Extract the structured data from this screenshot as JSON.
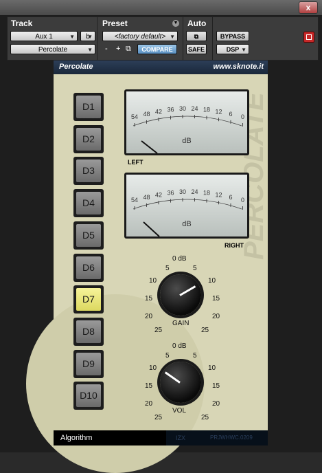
{
  "window": {
    "close_label": "x"
  },
  "header": {
    "track_label": "Track",
    "preset_label": "Preset",
    "auto_label": "Auto",
    "track_select": "Aux 1",
    "track_variant": "b",
    "plugin_select": "Percolate",
    "preset_select": "<factory default>",
    "minus": "-",
    "plus": "+",
    "compare": "COMPARE",
    "bypass": "BYPASS",
    "safe": "SAFE",
    "dsp": "DSP"
  },
  "plugin": {
    "name": "Percolate",
    "url": "www.sknote.it",
    "watermark": "PERCOLATE",
    "delay_buttons": [
      "D1",
      "D2",
      "D3",
      "D4",
      "D5",
      "D6",
      "D7",
      "D8",
      "D9",
      "D10"
    ],
    "active_button": "D7",
    "meters": {
      "scale": [
        "54",
        "48",
        "42",
        "36",
        "30",
        "24",
        "18",
        "12",
        "6",
        "0"
      ],
      "unit": "dB",
      "left_label": "LEFT",
      "right_label": "RIGHT"
    },
    "gain": {
      "label": "GAIN",
      "scale_top": "0 dB",
      "scale": [
        "5",
        "10",
        "15",
        "20",
        "25",
        "5",
        "10",
        "15",
        "20",
        "25"
      ]
    },
    "vol": {
      "label": "VOL",
      "scale_top": "0 dB",
      "scale": [
        "5",
        "10",
        "15",
        "20",
        "25",
        "5",
        "10",
        "15",
        "20",
        "25"
      ]
    },
    "algorithm": "Algorithm",
    "footer1": "IZX",
    "footer2": "PRJWHWC.0209"
  },
  "colors": {
    "panel": "#d8d6b6",
    "active": "#f0ee90",
    "topbar": "#1e2d42"
  }
}
